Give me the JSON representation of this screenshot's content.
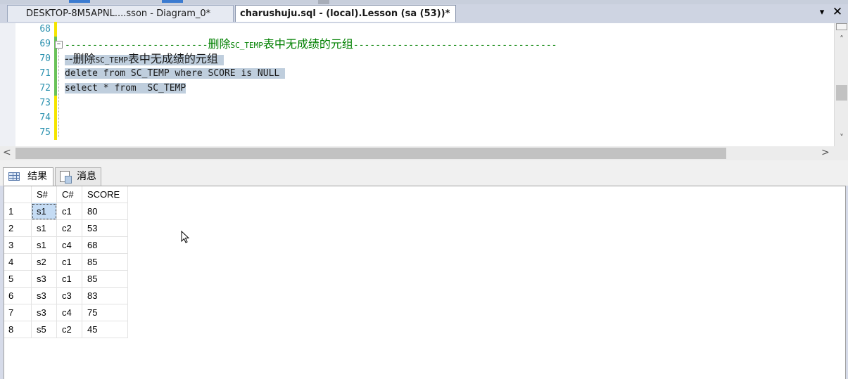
{
  "tabs": [
    {
      "label": "DESKTOP-8M5APNL....sson - Diagram_0*",
      "active": false
    },
    {
      "label": "charushuju.sql - (local).Lesson (sa (53))*",
      "active": true
    }
  ],
  "tabstrip_buttons": {
    "dropdown": "▾",
    "close": "✕"
  },
  "editor": {
    "line_numbers": [
      "68",
      "69",
      "70",
      "71",
      "72",
      "73",
      "74",
      "75"
    ],
    "line69": {
      "dashes_left": "--------------------------",
      "cn1": "删除",
      "code": "SC_TEMP",
      "cn2": "表中无成绩的元组",
      "dashes_right": "-------------------------------------"
    },
    "line70": {
      "prefix": "--删除",
      "code": "SC_TEMP",
      "cn": "表中无成绩的元组"
    },
    "line71": "delete from SC_TEMP where SCORE is NULL",
    "line72": "select * from  SC_TEMP"
  },
  "scroll": {
    "up": "˄",
    "down": "˅",
    "left": "<",
    "right": ">"
  },
  "results_tabs": {
    "results": "结果",
    "messages": "消息"
  },
  "results": {
    "columns": [
      "S#",
      "C#",
      "SCORE"
    ],
    "rows": [
      [
        "1",
        "s1",
        "c1",
        "80"
      ],
      [
        "2",
        "s1",
        "c2",
        "53"
      ],
      [
        "3",
        "s1",
        "c4",
        "68"
      ],
      [
        "4",
        "s2",
        "c1",
        "85"
      ],
      [
        "5",
        "s3",
        "c1",
        "85"
      ],
      [
        "6",
        "s3",
        "c3",
        "83"
      ],
      [
        "7",
        "s3",
        "c4",
        "75"
      ],
      [
        "8",
        "s5",
        "c2",
        "45"
      ]
    ]
  },
  "colors": {
    "accent": "#3b7bd0",
    "selection": "#bfcedd",
    "comment": "#008000",
    "line_number": "#2b91af"
  }
}
